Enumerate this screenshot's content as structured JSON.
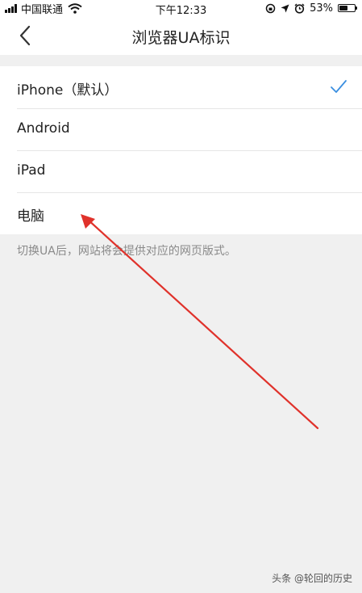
{
  "status_bar": {
    "carrier": "中国联通",
    "time": "下午12:33",
    "battery_percent": "53%",
    "battery_level": 0.53,
    "icons": [
      "signal-icon",
      "wifi-icon",
      "rotation-lock-icon",
      "location-icon",
      "alarm-icon",
      "battery-icon"
    ]
  },
  "nav": {
    "title": "浏览器UA标识",
    "back_icon": "chevron-left-icon"
  },
  "options": [
    {
      "label": "iPhone（默认）",
      "selected": true
    },
    {
      "label": "Android",
      "selected": false
    },
    {
      "label": "iPad",
      "selected": false
    },
    {
      "label": "电脑",
      "selected": false
    }
  ],
  "hint": "切换UA后，网站将会提供对应的网页版式。",
  "watermark": "头条 @轮回的历史",
  "colors": {
    "accent": "#3b8fe0",
    "annotation_arrow": "#e0322b",
    "background": "#f0f0f0"
  }
}
